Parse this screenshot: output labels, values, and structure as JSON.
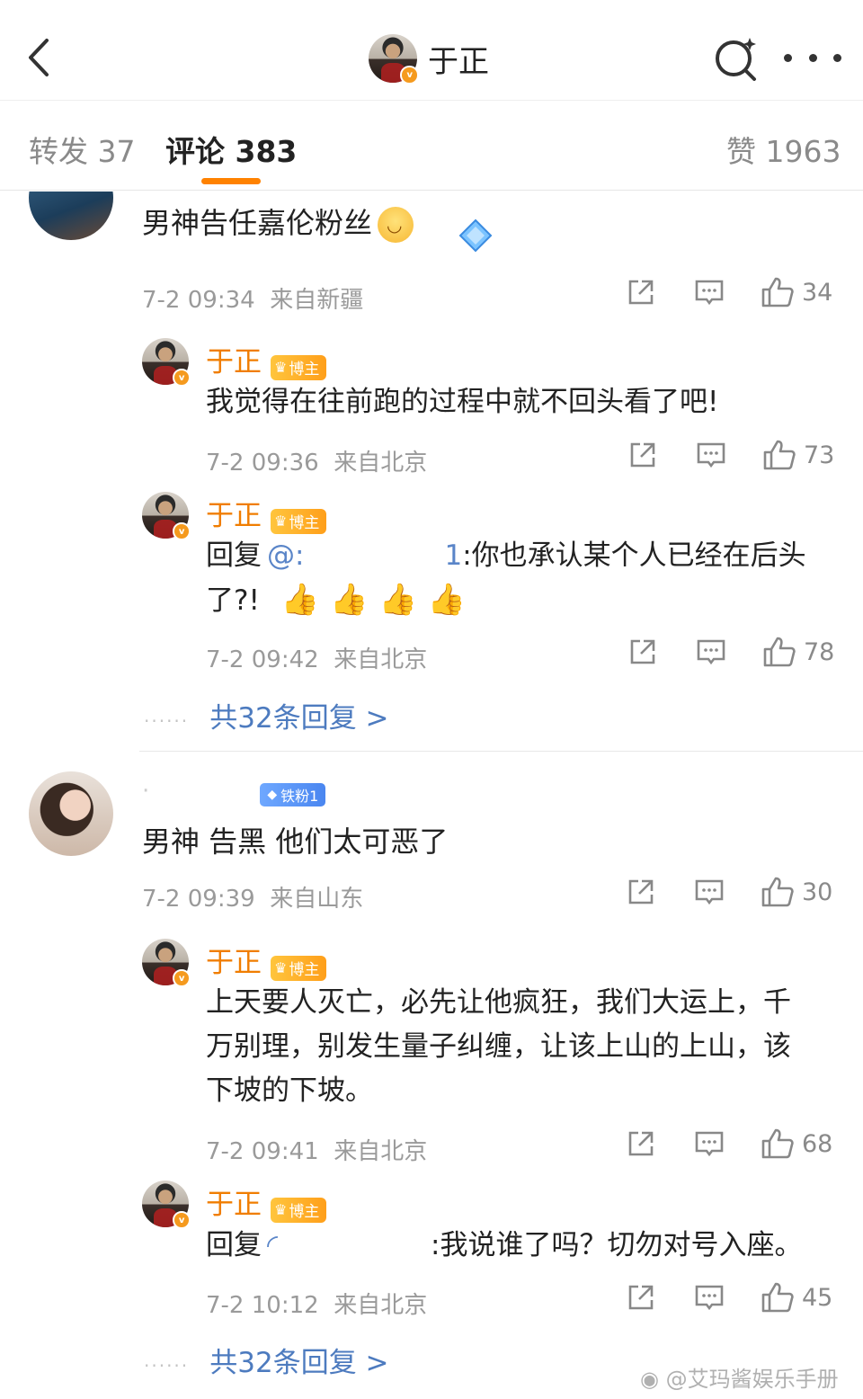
{
  "header": {
    "title": "于正",
    "back_icon": "chevron-left-icon",
    "search_icon": "search-sparkle-icon",
    "more_icon": "more-dots-icon"
  },
  "tabs": [
    {
      "label": "转发 37"
    },
    {
      "label": "评论 383"
    },
    {
      "label": "赞 1963"
    }
  ],
  "accent_color": "#ff8200",
  "comments": [
    {
      "text": "男神告任嘉伦粉丝",
      "time": "7-2 09:34",
      "location": "来自新疆",
      "likes": "34",
      "replies": [
        {
          "name": "于正",
          "badge": "博主",
          "text": "我觉得在往前跑的过程中就不回头看了吧!",
          "time": "7-2 09:36",
          "location": "来自北京",
          "likes": "73"
        },
        {
          "name": "于正",
          "badge": "博主",
          "prefix": "回复",
          "mention": "@:",
          "mention_tail": "1",
          "text": ":你也承认某个人已经在后头",
          "text2": "了?!",
          "time": "7-2 09:42",
          "location": "来自北京",
          "likes": "78"
        }
      ],
      "more_replies": "共32条回复 >"
    },
    {
      "fan_badge": "铁粉1",
      "text": "男神 告黑 他们太可恶了",
      "time": "7-2 09:39",
      "location": "来自山东",
      "likes": "30",
      "replies": [
        {
          "name": "于正",
          "badge": "博主",
          "lines": [
            "上天要人灭亡，必先让他疯狂，我们大运上，千",
            "万别理，别发生量子纠缠，让该上山的上山，该",
            "下坡的下坡。"
          ],
          "time": "7-2 09:41",
          "location": "来自北京",
          "likes": "68"
        },
        {
          "name": "于正",
          "badge": "博主",
          "prefix": "回复",
          "mention": "◜",
          "text": ":我说谁了吗？切勿对号入座。",
          "time": "7-2 10:12",
          "location": "来自北京",
          "likes": "45"
        }
      ],
      "more_replies": "共32条回复 >"
    }
  ],
  "watermark": "@艾玛酱娱乐手册"
}
